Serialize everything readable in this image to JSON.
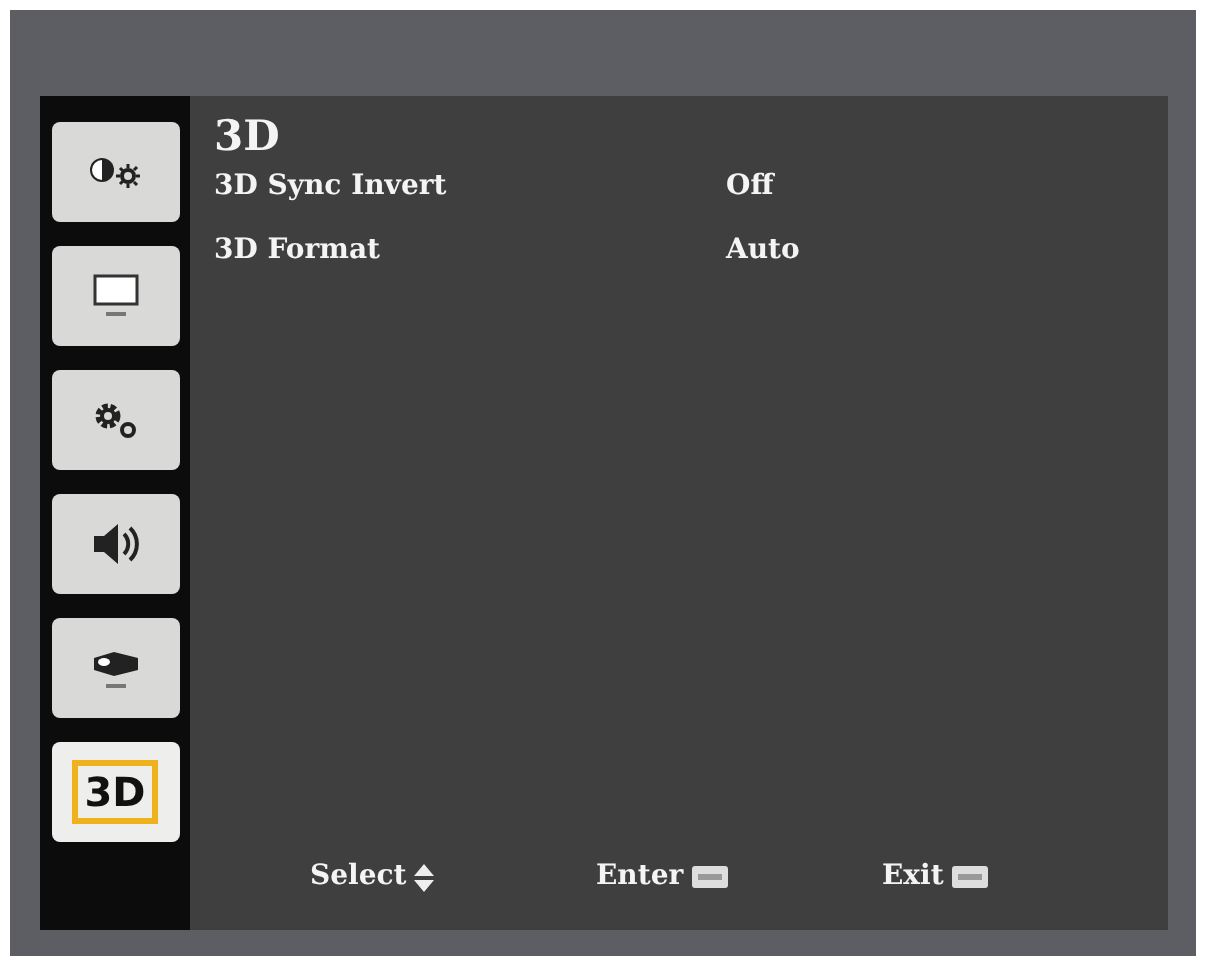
{
  "sidebar": {
    "items": [
      {
        "kind": "image",
        "selected": false
      },
      {
        "kind": "display",
        "selected": false
      },
      {
        "kind": "setup",
        "selected": false
      },
      {
        "kind": "audio",
        "selected": false
      },
      {
        "kind": "projector",
        "selected": false
      },
      {
        "kind": "label",
        "label": "3D",
        "selected": true
      }
    ]
  },
  "panel": {
    "title": "3D",
    "rows": [
      {
        "label": "3D Sync Invert",
        "value": "Off"
      },
      {
        "label": "3D Format",
        "value": "Auto"
      }
    ]
  },
  "footer": [
    {
      "label": "Select",
      "kind": "updown"
    },
    {
      "label": "Enter",
      "kind": "key"
    },
    {
      "label": "Exit",
      "kind": "key"
    }
  ]
}
